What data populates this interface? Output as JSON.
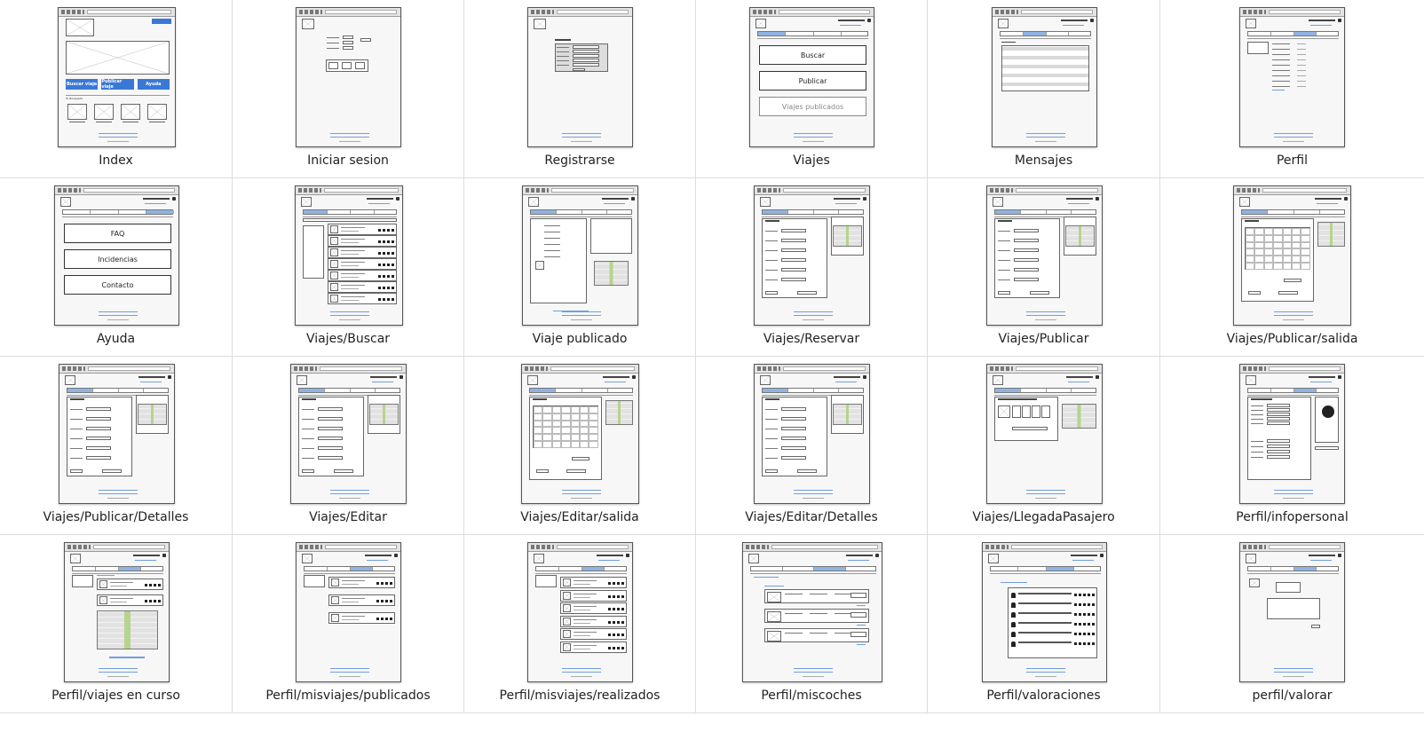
{
  "grid": {
    "rows": 4,
    "cols": 6,
    "cells": [
      {
        "caption": "Index",
        "kind": "index",
        "thumb": {
          "buttons": [
            "Buscar viaje",
            "Publicar viaje",
            "Ayuda"
          ],
          "top_label": "Tu Búsqueda"
        }
      },
      {
        "caption": "Iniciar sesion",
        "kind": "login"
      },
      {
        "caption": "Registrarse",
        "kind": "register"
      },
      {
        "caption": "Viajes",
        "kind": "bigbuttons",
        "thumb": {
          "buttons": [
            "Buscar",
            "Publicar",
            "Viajes publicados"
          ],
          "gray_last": true,
          "active_tab": 0
        }
      },
      {
        "caption": "Mensajes",
        "kind": "messages",
        "thumb": {
          "active_tab": 1
        }
      },
      {
        "caption": "Perfil",
        "kind": "profile",
        "thumb": {
          "active_tab": 2
        }
      },
      {
        "caption": "Ayuda",
        "kind": "bigbuttons",
        "thumb": {
          "buttons": [
            "FAQ",
            "Incidencias",
            "Contacto"
          ],
          "gray_last": false,
          "active_tab": 3
        }
      },
      {
        "caption": "Viajes/Buscar",
        "kind": "search",
        "thumb": {
          "active_tab": 0
        }
      },
      {
        "caption": "Viaje publicado",
        "kind": "published",
        "thumb": {
          "active_tab": 0
        }
      },
      {
        "caption": "Viajes/Reservar",
        "kind": "form_map",
        "thumb": {
          "active_tab": 0
        }
      },
      {
        "caption": "Viajes/Publicar",
        "kind": "form_map",
        "thumb": {
          "active_tab": 0
        }
      },
      {
        "caption": "Viajes/Publicar/salida",
        "kind": "calendar_map",
        "thumb": {
          "active_tab": 0
        }
      },
      {
        "caption": "Viajes/Publicar/Detalles",
        "kind": "form_map",
        "thumb": {
          "active_tab": 0
        }
      },
      {
        "caption": "Viajes/Editar",
        "kind": "form_map",
        "thumb": {
          "active_tab": 0
        }
      },
      {
        "caption": "Viajes/Editar/salida",
        "kind": "calendar_map",
        "thumb": {
          "active_tab": 0
        }
      },
      {
        "caption": "Viajes/Editar/Detalles",
        "kind": "form_map",
        "thumb": {
          "active_tab": 0
        }
      },
      {
        "caption": "Viajes/LlegadaPasajero",
        "kind": "arrival",
        "thumb": {
          "active_tab": 0
        }
      },
      {
        "caption": "Perfil/infopersonal",
        "kind": "infopersonal",
        "thumb": {
          "active_tab": 2
        }
      },
      {
        "caption": "Perfil/viajes en curso",
        "kind": "current_trips",
        "thumb": {
          "active_tab": 2
        }
      },
      {
        "caption": "Perfil/misviajes/publicados",
        "kind": "trip_list",
        "thumb": {
          "active_tab": 2,
          "rows": 3
        }
      },
      {
        "caption": "Perfil/misviajes/realizados",
        "kind": "trip_list",
        "thumb": {
          "active_tab": 2,
          "rows": 6
        }
      },
      {
        "caption": "Perfil/miscoches",
        "kind": "cars",
        "thumb": {
          "active_tab": 2
        }
      },
      {
        "caption": "Perfil/valoraciones",
        "kind": "ratings",
        "thumb": {
          "active_tab": 2
        }
      },
      {
        "caption": "perfil/valorar",
        "kind": "rate",
        "thumb": {
          "active_tab": 2
        }
      }
    ]
  }
}
